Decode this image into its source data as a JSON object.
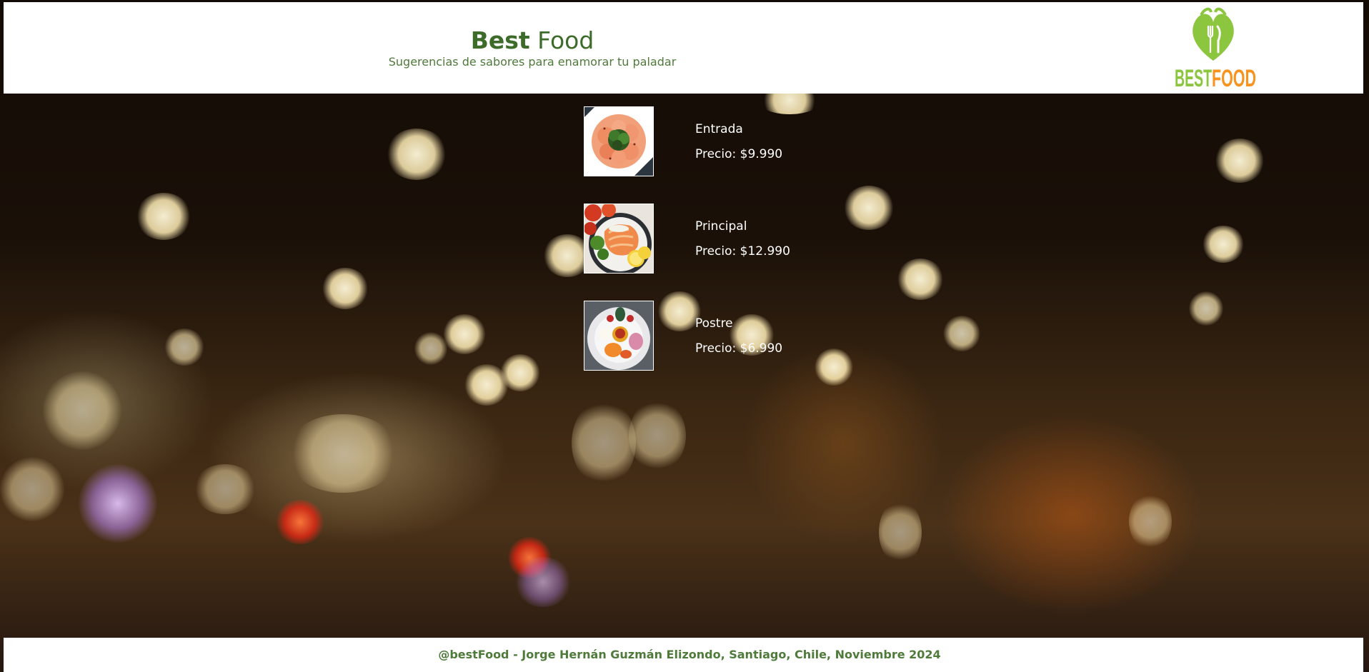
{
  "header": {
    "title_bold": "Best",
    "title_light": "Food",
    "subtitle": "Sugerencias de sabores para enamorar tu paladar",
    "logo": {
      "icon": "heart-fork-knife-icon",
      "text_part1": "BEST",
      "text_part2": "FOOD",
      "colors": {
        "green": "#8cc63f",
        "orange": "#f7931e"
      }
    }
  },
  "menu": {
    "items": [
      {
        "name": "Entrada",
        "price_label": "Precio:",
        "price": "$9.990",
        "image": "carpaccio-photo"
      },
      {
        "name": "Principal",
        "price_label": "Precio:",
        "price": "$12.990",
        "image": "salmon-photo"
      },
      {
        "name": "Postre",
        "price_label": "Precio:",
        "price": "$6.990",
        "image": "dessert-plate-photo"
      }
    ]
  },
  "footer": {
    "text": "@bestFood - Jorge Hernán Guzmán Elizondo, Santiago, Chile, Noviembre 2024"
  },
  "colors": {
    "brand_green": "#3d6b2a",
    "text_white": "#ffffff"
  }
}
